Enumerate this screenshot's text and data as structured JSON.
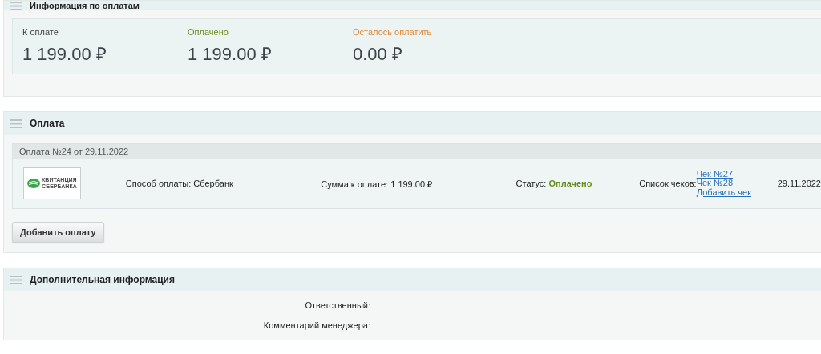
{
  "payment_summary": {
    "title": "Информация по оплатам",
    "items": [
      {
        "kind": "due",
        "label": "К оплате",
        "amount": "1 199.00 ₽"
      },
      {
        "kind": "paid",
        "label": "Оплачено",
        "amount": "1 199.00 ₽"
      },
      {
        "kind": "remaining",
        "label": "Осталось оплатить",
        "amount": "0.00 ₽"
      }
    ]
  },
  "payments": {
    "title": "Оплата",
    "items": [
      {
        "header": "Оплата №24 от 29.11.2022",
        "logo_text": [
          "КВИТАНЦИЯ",
          "СБЕРБАНКА"
        ],
        "method": "Способ оплаты: Сбербанк",
        "sum": "Сумма к оплате: 1 199.00 ₽",
        "status_label": "Статус:",
        "status": "Оплачено",
        "paid": true,
        "receipts_label": "Список чеков:",
        "receipts": [
          "Чек №27",
          "Чек №28"
        ],
        "add_receipt": "Добавить чек",
        "date": "29.11.2022"
      }
    ],
    "add_button": "Добавить оплату"
  },
  "additional": {
    "title": "Дополнительная информация",
    "fields": [
      {
        "label": "Ответственный:"
      },
      {
        "label": "Комментарий менеджера:"
      }
    ]
  }
}
